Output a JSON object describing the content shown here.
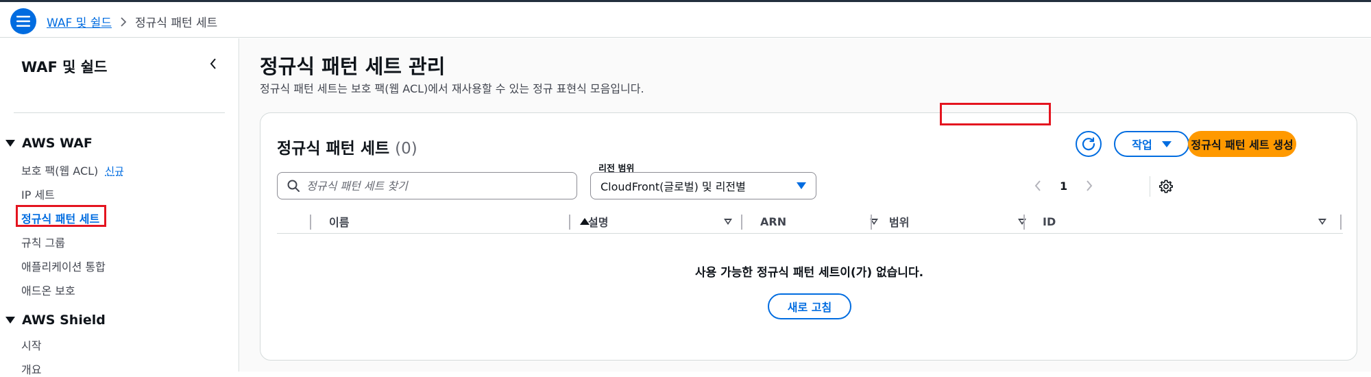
{
  "topbar": {
    "menu_icon": "hamburger-icon",
    "breadcrumb": {
      "root": "WAF 및 쉴드",
      "current": "정규식 패턴 세트"
    }
  },
  "sidebar": {
    "title": "WAF 및 쉴드",
    "sections": [
      {
        "label": "AWS WAF",
        "items": [
          {
            "label": "보호 팩(웹 ACL)",
            "badge": "신규"
          },
          {
            "label": "IP 세트"
          },
          {
            "label": "정규식 패턴 세트",
            "active": true
          },
          {
            "label": "규칙 그룹"
          },
          {
            "label": "애플리케이션 통합"
          },
          {
            "label": "애드온 보호"
          }
        ]
      },
      {
        "label": "AWS Shield",
        "items": [
          {
            "label": "시작"
          },
          {
            "label": "개요"
          }
        ]
      }
    ]
  },
  "main": {
    "title": "정규식 패턴 세트 관리",
    "description": "정규식 패턴 세트는 보호 팩(웹 ACL)에서 재사용할 수 있는 정규 표현식 모음입니다.",
    "panel": {
      "title": "정규식 패턴 세트",
      "count": "(0)",
      "actions_label": "작업",
      "create_label": "정규식 패턴 세트 생성",
      "search_placeholder": "정규식 패턴 세트 찾기",
      "region_label": "리전 범위",
      "region_value": "CloudFront(글로벌) 및 리전별",
      "page": "1",
      "columns": [
        "이름",
        "설명",
        "ARN",
        "범위",
        "ID"
      ],
      "empty_message": "사용 가능한 정규식 패턴 세트이(가) 없습니다.",
      "refresh_label": "새로 고침"
    }
  },
  "colors": {
    "accent": "#006ce0",
    "primary_button": "#ff9900",
    "highlight": "#e4141f"
  }
}
